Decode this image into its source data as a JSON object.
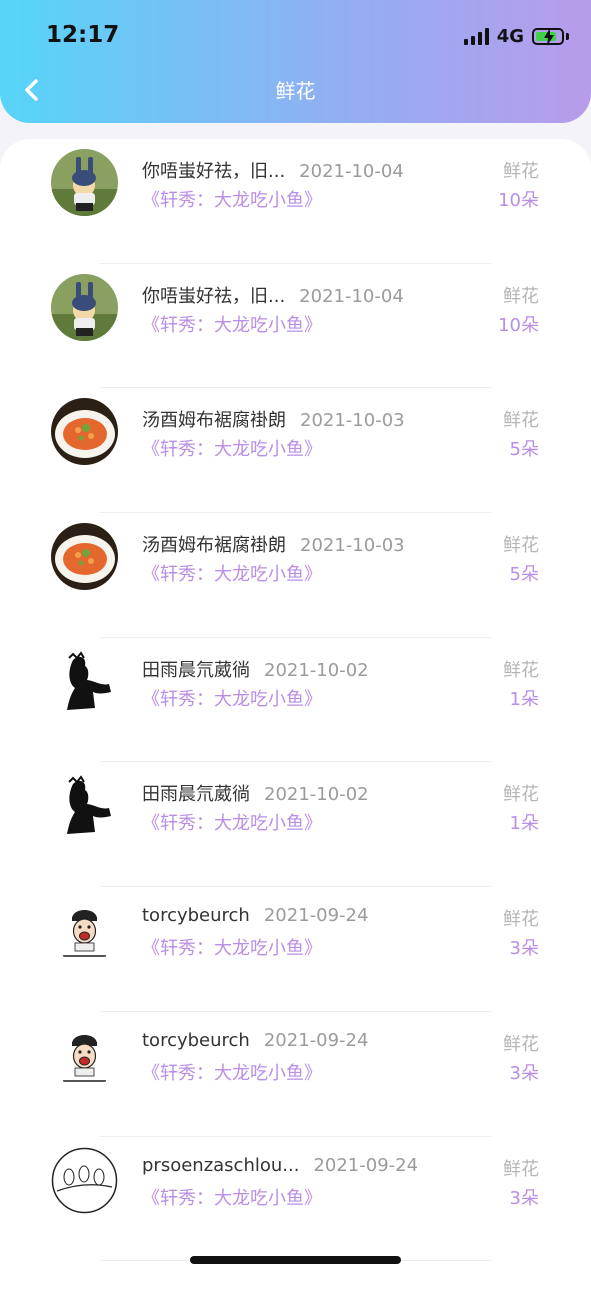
{
  "status_bar": {
    "time": "12:17",
    "network": "4G"
  },
  "header": {
    "title": "鲜花"
  },
  "colors": {
    "gradient_start": "#56d5f8",
    "gradient_end": "#b89cec",
    "accent": "#b98ee6"
  },
  "records": [
    {
      "name": "你唔蚩好祛，旧...",
      "date": "2021-10-04",
      "gift": "《轩秀：大龙吃小鱼》",
      "kind": "鲜花",
      "count": "10朵",
      "avatar": "bunny-figure-avatar"
    },
    {
      "name": "你唔蚩好祛，旧...",
      "date": "2021-10-04",
      "gift": "《轩秀：大龙吃小鱼》",
      "kind": "鲜花",
      "count": "10朵",
      "avatar": "bunny-figure-avatar"
    },
    {
      "name": "汤酉姆布裾腐褂朗",
      "date": "2021-10-03",
      "gift": "《轩秀：大龙吃小鱼》",
      "kind": "鲜花",
      "count": "5朵",
      "avatar": "food-plate-avatar"
    },
    {
      "name": "汤酉姆布裾腐褂朗",
      "date": "2021-10-03",
      "gift": "《轩秀：大龙吃小鱼》",
      "kind": "鲜花",
      "count": "5朵",
      "avatar": "food-plate-avatar"
    },
    {
      "name": "田雨晨氘葳徜",
      "date": "2021-10-02",
      "gift": "《轩秀：大龙吃小鱼》",
      "kind": "鲜花",
      "count": "1朵",
      "avatar": "silhouette-avatar"
    },
    {
      "name": "田雨晨氘葳徜",
      "date": "2021-10-02",
      "gift": "《轩秀：大龙吃小鱼》",
      "kind": "鲜花",
      "count": "1朵",
      "avatar": "silhouette-avatar"
    },
    {
      "name": "torcybeurch",
      "date": "2021-09-24",
      "gift": "《轩秀：大龙吃小鱼》",
      "kind": "鲜花",
      "count": "3朵",
      "avatar": "cartoon-face-avatar"
    },
    {
      "name": "torcybeurch",
      "date": "2021-09-24",
      "gift": "《轩秀：大龙吃小鱼》",
      "kind": "鲜花",
      "count": "3朵",
      "avatar": "cartoon-face-avatar"
    },
    {
      "name": "prsoenzaschlou...",
      "date": "2021-09-24",
      "gift": "《轩秀：大龙吃小鱼》",
      "kind": "鲜花",
      "count": "3朵",
      "avatar": "birds-sketch-avatar"
    }
  ]
}
